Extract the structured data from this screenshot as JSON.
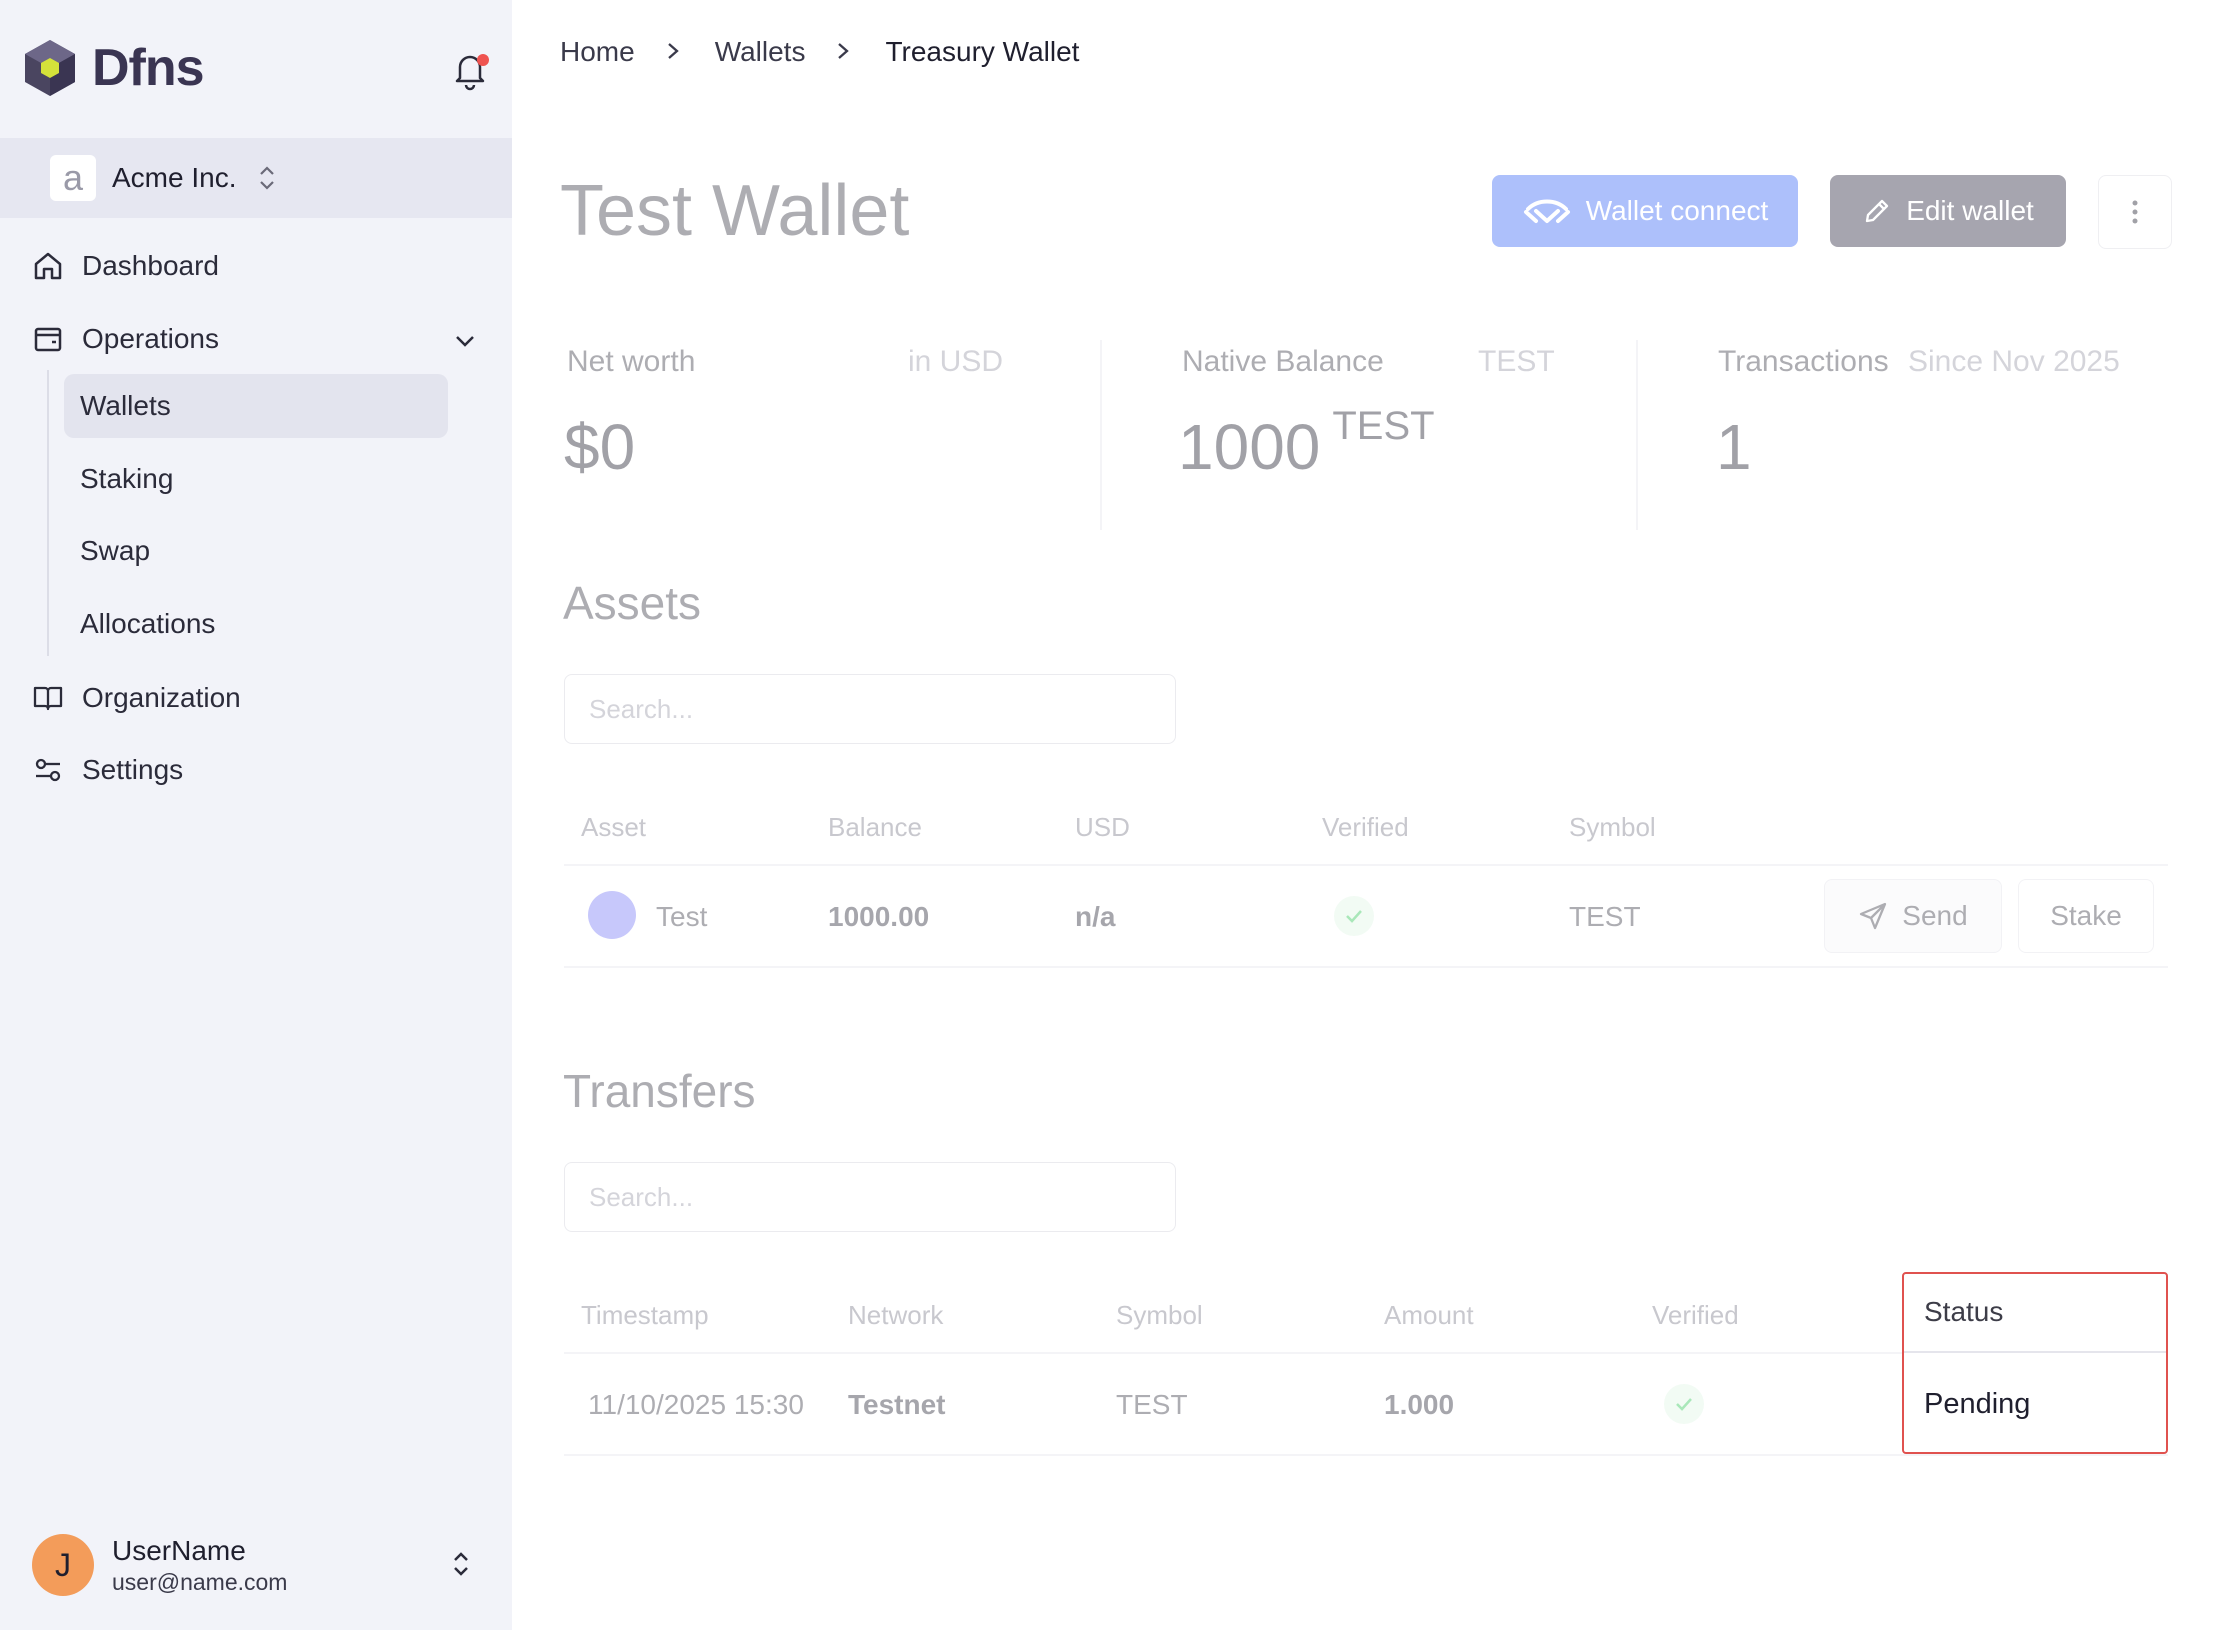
{
  "app": {
    "logo_text": "Dfns"
  },
  "org": {
    "avatar_letter": "a",
    "name": "Acme Inc."
  },
  "nav": {
    "dashboard": "Dashboard",
    "operations": "Operations",
    "sub": {
      "wallets": "Wallets",
      "staking": "Staking",
      "swap": "Swap",
      "allocations": "Allocations"
    },
    "organization": "Organization",
    "settings": "Settings"
  },
  "user": {
    "initial": "J",
    "name": "UserName",
    "email": "user@name.com"
  },
  "breadcrumb": {
    "home": "Home",
    "wallets": "Wallets",
    "current": "Treasury Wallet"
  },
  "page": {
    "title": "Test Wallet",
    "wallet_connect": "Wallet connect",
    "edit_wallet": "Edit wallet"
  },
  "stats": {
    "net_worth": {
      "label": "Net worth",
      "sub": "in USD",
      "value": "$0"
    },
    "native_balance": {
      "label": "Native Balance",
      "sub": "TEST",
      "value": "1000",
      "unit": "TEST"
    },
    "transactions": {
      "label": "Transactions",
      "sub": "Since Nov 2025",
      "value": "1"
    }
  },
  "assets": {
    "title": "Assets",
    "search_placeholder": "Search...",
    "columns": [
      "Asset",
      "Balance",
      "USD",
      "Verified",
      "Symbol"
    ],
    "rows": [
      {
        "asset": "Test",
        "balance": "1000.00",
        "usd": "n/a",
        "verified": true,
        "symbol": "TEST"
      }
    ],
    "send": "Send",
    "stake": "Stake"
  },
  "transfers": {
    "title": "Transfers",
    "search_placeholder": "Search...",
    "columns": [
      "Timestamp",
      "Network",
      "Symbol",
      "Amount",
      "Verified",
      "Status"
    ],
    "rows": [
      {
        "timestamp": "11/10/2025 15:30",
        "network": "Testnet",
        "symbol": "TEST",
        "amount": "1.000",
        "verified": true,
        "status": "Pending"
      }
    ]
  },
  "colors": {
    "accent": "#3c6af6",
    "notification": "#ef5350",
    "highlight": "#e0524f",
    "avatar": "#f39c5a"
  }
}
